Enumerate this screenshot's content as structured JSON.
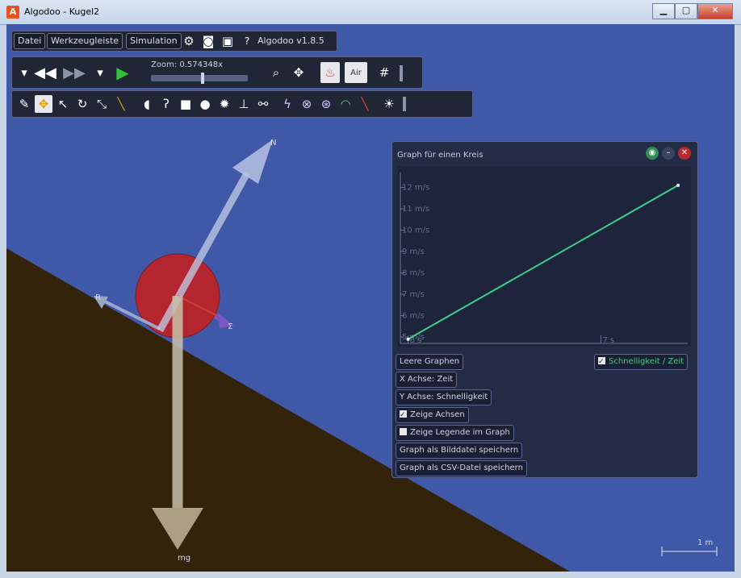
{
  "window": {
    "title": "Algodoo - Kugel2",
    "icon": "algodoo-app-icon"
  },
  "menu": {
    "file": "Datei",
    "toolbar": "Werkzeugleiste",
    "simulation": "Simulation",
    "version": "Algodoo v1.8.5"
  },
  "sim_toolbar": {
    "zoom_label": "Zoom: 0.574348x"
  },
  "scene_labels": {
    "normal_force": "N",
    "friction": "R",
    "sum": "Σ",
    "weight": "mg",
    "scale": "1 m"
  },
  "graph_panel": {
    "title": "Graph für einen Kreis",
    "buttons": {
      "clear": "Leere Graphen",
      "x_axis": "X Achse: Zeit",
      "y_axis": "Y Achse: Schnelligkeit",
      "show_axes": "Zeige Achsen",
      "show_legend": "Zeige Legende im Graph",
      "save_image": "Graph als Bilddatei speichern",
      "save_csv": "Graph als CSV-Datei speichern"
    },
    "legend_series": "Schnelligkeit / Zeit",
    "show_axes_checked": true,
    "show_legend_checked": false,
    "series_checked": true
  },
  "chart_data": {
    "type": "line",
    "title": "",
    "xlabel": "",
    "ylabel": "",
    "x_ticks": [
      "6 s",
      "7 s"
    ],
    "y_ticks": [
      "5 m/s",
      "6 m/s",
      "7 m/s",
      "8 m/s",
      "9 m/s",
      "10 m/s",
      "11 m/s",
      "12 m/s"
    ],
    "xlim": [
      5.96,
      7.45
    ],
    "ylim": [
      4.7,
      12.7
    ],
    "series": [
      {
        "name": "Schnelligkeit / Zeit",
        "color": "#3ccf8e",
        "x": [
          6.0,
          7.4
        ],
        "y": [
          4.9,
          12.1
        ]
      }
    ]
  },
  "colors": {
    "sky": "#3f58a8",
    "ground": "#33230b",
    "ball": "#b32630",
    "series": "#3ccf8e"
  }
}
